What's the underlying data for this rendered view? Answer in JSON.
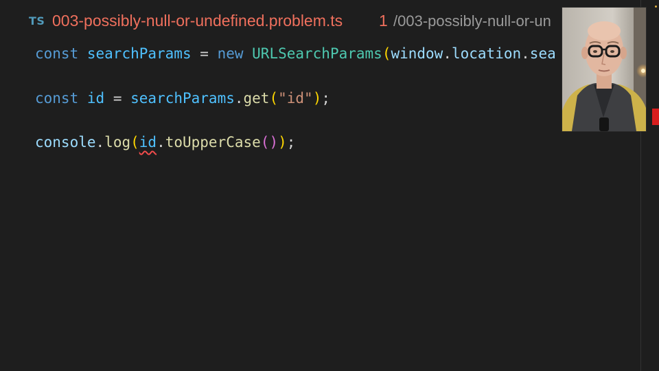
{
  "tab": {
    "language_badge": "TS",
    "filename": "003-possibly-null-or-undefined.problem.ts",
    "problem_count": "1",
    "path": "/003-possibly-null-or-un"
  },
  "code": {
    "line1": {
      "keyword": "const",
      "name": "searchParams",
      "eq": "=",
      "new_kw": "new",
      "class_name": "URLSearchParams",
      "open_paren": "(",
      "obj1": "window",
      "dot1": ".",
      "obj2": "location",
      "dot2": ".",
      "prop": "sea"
    },
    "line2": {
      "keyword": "const",
      "name": "id",
      "eq": "=",
      "obj": "searchParams",
      "dot": ".",
      "method": "get",
      "open_paren": "(",
      "string": "\"id\"",
      "close_paren": ")",
      "semicolon": ";"
    },
    "line3": {
      "obj": "console",
      "dot1": ".",
      "method": "log",
      "open_paren": "(",
      "arg": "id",
      "dot2": ".",
      "method2": "toUpperCase",
      "inner_parens": "()",
      "close_paren": ")",
      "semicolon": ";"
    }
  },
  "colors": {
    "background": "#1e1e1e",
    "keyword": "#569cd6",
    "variable": "#4fc1ff",
    "class": "#4ec9b0",
    "function": "#dcdcaa",
    "string": "#ce9178",
    "error": "#f14c4c",
    "tab_filename_error": "#f0705d"
  },
  "webcam": {
    "icon": "presenter-webcam"
  }
}
